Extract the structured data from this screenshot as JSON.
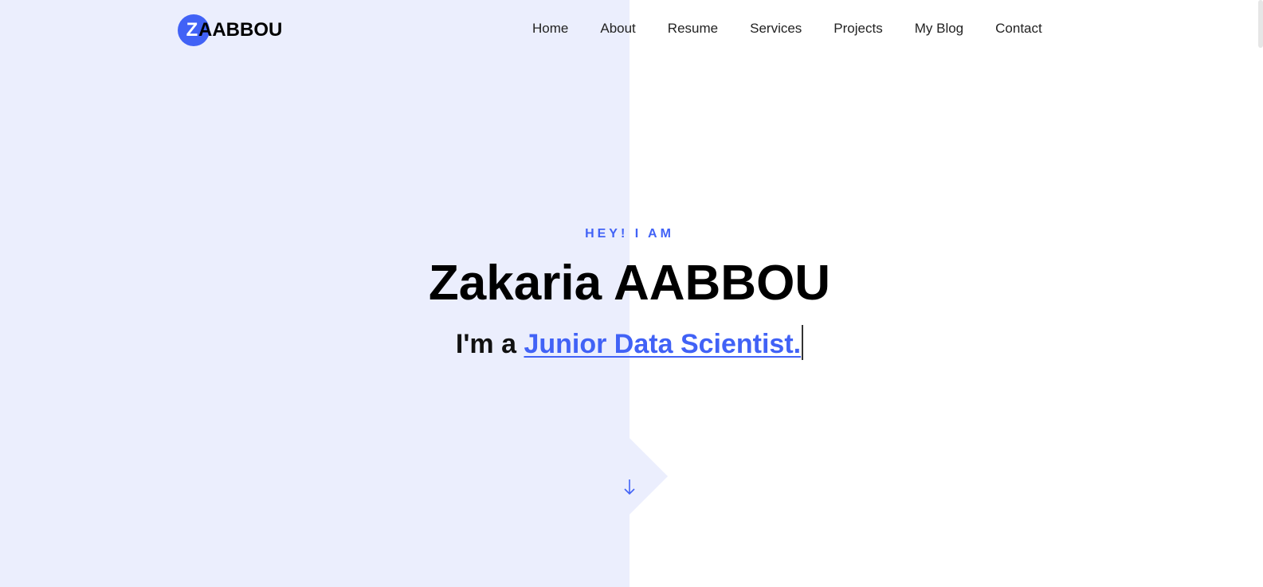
{
  "brand": {
    "logo_letter": "Z",
    "logo_text": "AABBOU",
    "accent_color": "#4162f6",
    "panel_color": "#ebeefd"
  },
  "nav": {
    "items": [
      "Home",
      "About",
      "Resume",
      "Services",
      "Projects",
      "My Blog",
      "Contact"
    ]
  },
  "hero": {
    "eyebrow": "HEY! I AM",
    "name": "Zakaria AABBOU",
    "tagline_prefix": "I'm a",
    "tagline_role": "Junior Data Scientist."
  },
  "scroll": {
    "icon": "arrow-down-icon"
  }
}
